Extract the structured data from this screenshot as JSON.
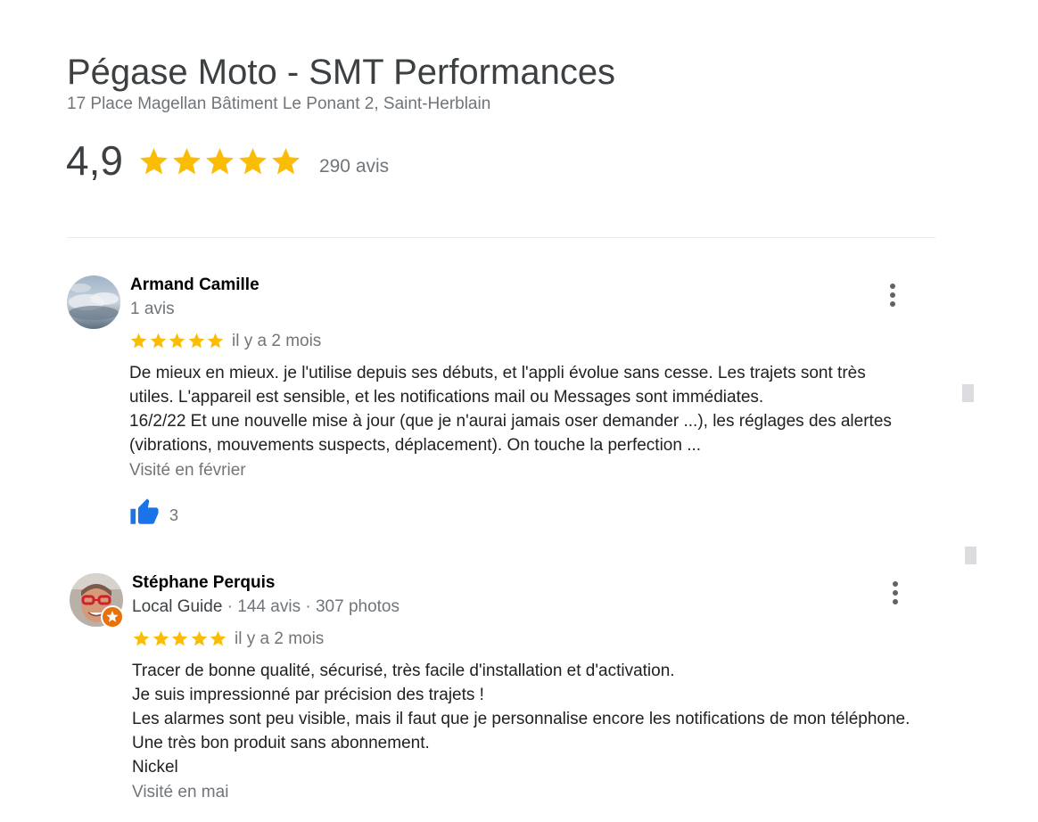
{
  "place": {
    "name": "Pégase Moto - SMT Performances",
    "address": "17 Place Magellan Bâtiment Le Ponant 2, Saint-Herblain",
    "rating": "4,9",
    "stars": 5,
    "review_count": "290 avis"
  },
  "colors": {
    "star": "#fbbc04",
    "like": "#1a73e8",
    "muted_text": "#70757a",
    "guide_badge": "#e8710a"
  },
  "reviews": [
    {
      "name": "Armand Camille",
      "meta": "1 avis",
      "stars": 5,
      "date": "il y a 2 mois",
      "text_lines": [
        "De mieux en mieux. je l'utilise depuis ses débuts, et l'appli évolue sans cesse. Les trajets sont très",
        "utiles. L'appareil est sensible, et les notifications mail ou Messages sont immédiates.",
        "16/2/22 Et une nouvelle mise à jour (que je n'aurai jamais oser demander ...), les réglages des alertes",
        "(vibrations, mouvements suspects, déplacement). On touche la perfection ..."
      ],
      "visited": "Visité en février",
      "likes": "3",
      "more_icon": "more-vert-icon",
      "like_icon": "thumbs-up-icon"
    },
    {
      "name": "Stéphane Perquis",
      "meta_guide": "Local Guide",
      "meta_sep1": " · ",
      "meta_reviews": "144 avis",
      "meta_sep2": " · ",
      "meta_photos": "307 photos",
      "stars": 5,
      "date": "il y a 2 mois",
      "text_lines": [
        "Tracer de bonne qualité, sécurisé, très facile d'installation et d'activation.",
        "Je suis impressionné par précision des trajets !",
        "Les alarmes sont peu visible, mais il faut que je personnalise encore les notifications de mon téléphone.",
        "Une très bon produit sans abonnement.",
        "Nickel"
      ],
      "visited": "Visité en mai",
      "more_icon": "more-vert-icon"
    }
  ]
}
